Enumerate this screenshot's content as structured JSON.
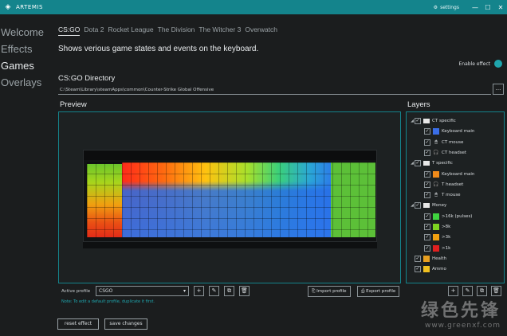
{
  "window": {
    "title": "ARTEMIS",
    "settings_label": "settings",
    "minimize": "—",
    "maximize": "☐",
    "close": "✕"
  },
  "sidebar": {
    "items": [
      {
        "label": "Welcome"
      },
      {
        "label": "Effects"
      },
      {
        "label": "Games",
        "active": true
      },
      {
        "label": "Overlays"
      }
    ]
  },
  "tabs": [
    {
      "label": "CS:GO",
      "active": true
    },
    {
      "label": "Dota 2"
    },
    {
      "label": "Rocket League"
    },
    {
      "label": "The Division"
    },
    {
      "label": "The Witcher 3"
    },
    {
      "label": "Overwatch"
    }
  ],
  "description": "Shows verious game states and events on the keyboard.",
  "enable_effect_label": "Enable effect",
  "directory": {
    "label": "CS:GO Directory",
    "value": "C:\\Steam\\Library\\steamApps\\common\\Counter-Strike Global Offensive",
    "browse_label": "..."
  },
  "preview": {
    "title": "Preview"
  },
  "profile": {
    "label": "Active profile",
    "selected": "CSGO",
    "caret": "▾",
    "note": "Note: To edit a default profile, duplicate it first.",
    "import_label": "Import profile",
    "export_label": "Export profile",
    "add_icon": "+",
    "edit_icon": "✎",
    "duplicate_icon": "⧉",
    "delete_icon": "🗑"
  },
  "footer": {
    "reset_label": "reset effect",
    "save_label": "save changes"
  },
  "layers": {
    "title": "Layers",
    "items": [
      {
        "label": "CT specific",
        "indent": 0,
        "type": "folder",
        "expanded": true
      },
      {
        "label": "Keyboard main",
        "indent": 1,
        "type": "keyboard",
        "color": "#3a6ee8"
      },
      {
        "label": "CT mouse",
        "indent": 1,
        "type": "mouse"
      },
      {
        "label": "CT headset",
        "indent": 1,
        "type": "headset"
      },
      {
        "label": "T specific",
        "indent": 0,
        "type": "folder",
        "expanded": true
      },
      {
        "label": "Keyboard main",
        "indent": 1,
        "type": "keyboard",
        "color": "#f08a1a"
      },
      {
        "label": "T headset",
        "indent": 1,
        "type": "headset"
      },
      {
        "label": "T mouse",
        "indent": 1,
        "type": "mouse"
      },
      {
        "label": "Money",
        "indent": 0,
        "type": "folder",
        "expanded": true
      },
      {
        "label": ">16k (pulses)",
        "indent": 1,
        "type": "keyboard",
        "color": "#3fd33f"
      },
      {
        "label": ">8k",
        "indent": 1,
        "type": "keyboard",
        "color": "#7ed321"
      },
      {
        "label": ">3k",
        "indent": 1,
        "type": "keyboard",
        "color": "#f0a010"
      },
      {
        "label": ">1k",
        "indent": 1,
        "type": "keyboard",
        "color": "#e02020"
      },
      {
        "label": "Health",
        "indent": 0,
        "type": "keyboard",
        "color": "#e8a020"
      },
      {
        "label": "Ammo",
        "indent": 0,
        "type": "keyboard",
        "color": "#f0c020"
      }
    ]
  },
  "watermark": {
    "line1": "绿色先锋",
    "line2": "www.greenxf.com"
  }
}
